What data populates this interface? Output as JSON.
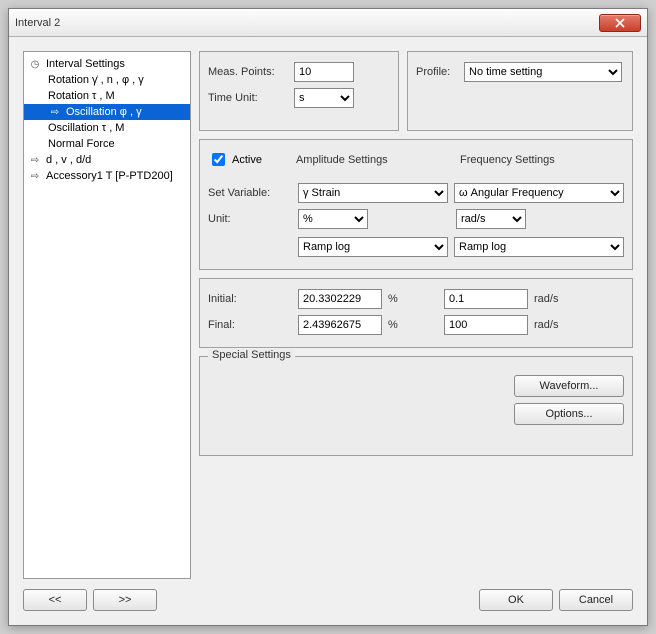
{
  "window": {
    "title": "Interval 2"
  },
  "tree": {
    "items": [
      {
        "icon": "clock",
        "label": "Interval Settings",
        "indent": false
      },
      {
        "icon": "",
        "label": "Rotation  γ̇ , n , φ , γ",
        "indent": true
      },
      {
        "icon": "",
        "label": "Rotation  τ , M",
        "indent": true
      },
      {
        "icon": "arrow",
        "label": "Oscillation  φ , γ",
        "indent": true,
        "selected": true
      },
      {
        "icon": "",
        "label": "Oscillation  τ , M",
        "indent": true
      },
      {
        "icon": "",
        "label": "Normal Force",
        "indent": true
      },
      {
        "icon": "arrow",
        "label": "d , v , d/d",
        "indent": false
      },
      {
        "icon": "arrow",
        "label": "Accessory1  T [P-PTD200]",
        "indent": false
      }
    ]
  },
  "top": {
    "meas_points_label": "Meas. Points:",
    "meas_points_value": "10",
    "time_unit_label": "Time Unit:",
    "time_unit_value": "s",
    "profile_label": "Profile:",
    "profile_value": "No time setting"
  },
  "main": {
    "active_label": "Active",
    "active_checked": true,
    "amplitude_header": "Amplitude Settings",
    "frequency_header": "Frequency Settings",
    "set_variable_label": "Set Variable:",
    "amp_variable": "γ     Strain",
    "freq_variable": "ω   Angular Frequency",
    "unit_label": "Unit:",
    "amp_unit": "%",
    "freq_unit": "rad/s",
    "amp_ramp": "Ramp log",
    "freq_ramp": "Ramp log"
  },
  "values": {
    "initial_label": "Initial:",
    "final_label": "Final:",
    "amp_initial": "20.3302229",
    "amp_final": "2.43962675",
    "amp_unit": "%",
    "freq_initial": "0.1",
    "freq_final": "100",
    "freq_unit": "rad/s"
  },
  "special": {
    "title": "Special Settings",
    "waveform": "Waveform...",
    "options": "Options..."
  },
  "buttons": {
    "prev": "<<",
    "next": ">>",
    "ok": "OK",
    "cancel": "Cancel"
  }
}
